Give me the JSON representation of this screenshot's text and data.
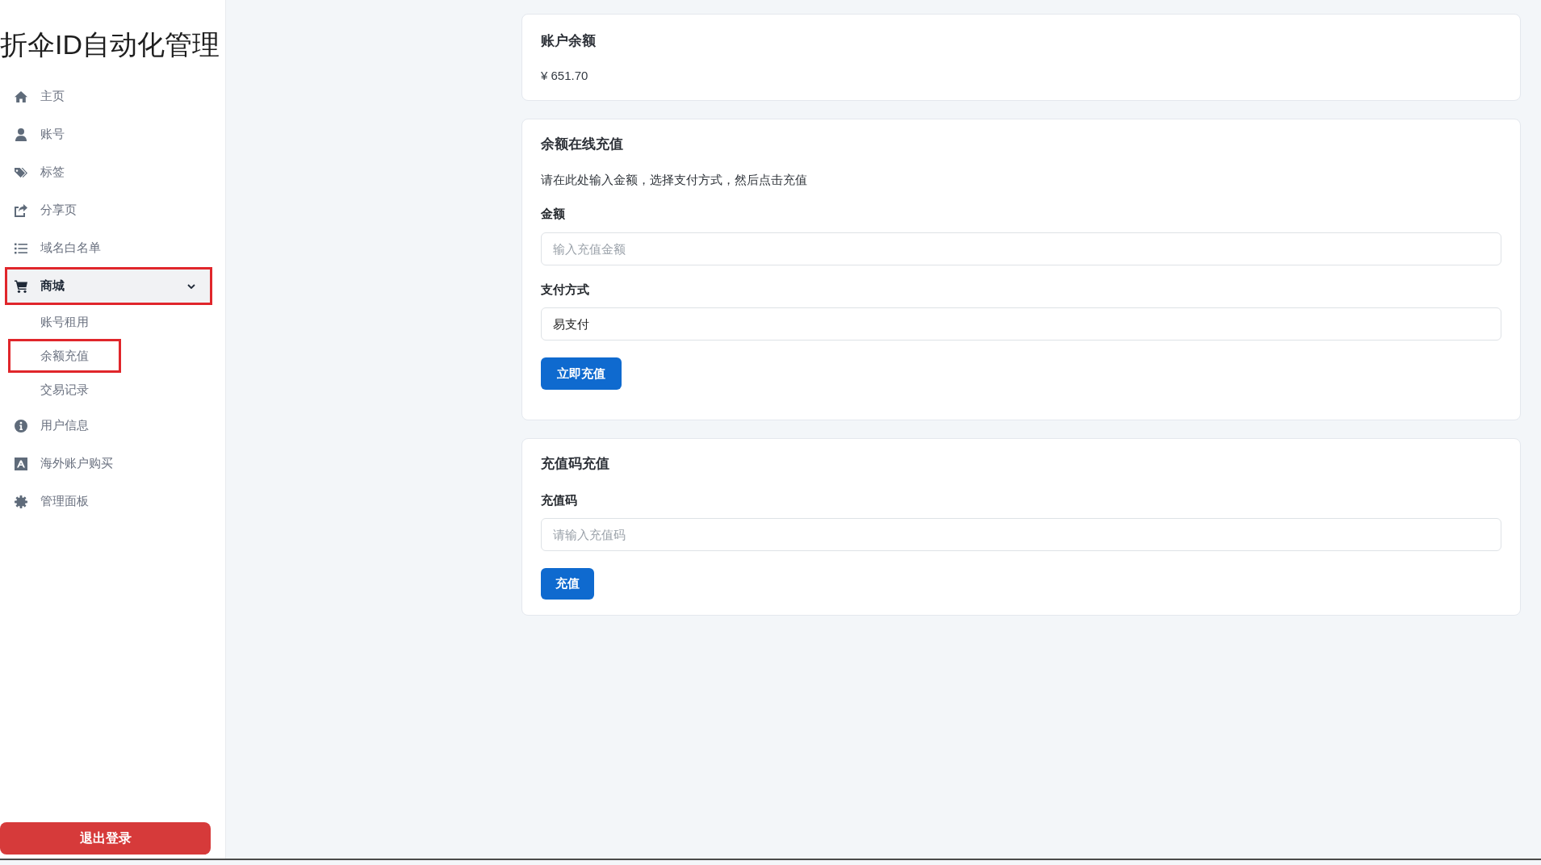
{
  "sidebar": {
    "title": "折伞ID自动化管理",
    "items": [
      {
        "label": "主页",
        "selected": false,
        "highlighted": false
      },
      {
        "label": "账号",
        "selected": false,
        "highlighted": false
      },
      {
        "label": "标签",
        "selected": false,
        "highlighted": false
      },
      {
        "label": "分享页",
        "selected": false,
        "highlighted": false
      },
      {
        "label": "域名白名单",
        "selected": false,
        "highlighted": false
      },
      {
        "label": "商城",
        "selected": true,
        "highlighted": true,
        "expanded": true,
        "children": [
          {
            "label": "账号租用",
            "selected": false,
            "highlighted": false
          },
          {
            "label": "余额充值",
            "selected": false,
            "highlighted": true
          },
          {
            "label": "交易记录",
            "selected": false,
            "highlighted": false
          }
        ]
      },
      {
        "label": "用户信息",
        "selected": false,
        "highlighted": false
      },
      {
        "label": "海外账户购买",
        "selected": false,
        "highlighted": false
      },
      {
        "label": "管理面板",
        "selected": false,
        "highlighted": false
      }
    ],
    "logout_button": "退出登录"
  },
  "balance_card": {
    "title": "账户余额",
    "amount": "¥ 651.70"
  },
  "online_recharge": {
    "title": "余额在线充值",
    "description": "请在此处输入金额，选择支付方式，然后点击充值",
    "amount_field": {
      "label": "金额",
      "placeholder": "输入充值金额"
    },
    "payment_field": {
      "label": "支付方式",
      "value": "易支付"
    },
    "button": "立即充值"
  },
  "code_recharge": {
    "title": "充值码充值",
    "code_field": {
      "label": "充值码",
      "placeholder": "请输入充值码"
    },
    "button": "充值"
  }
}
